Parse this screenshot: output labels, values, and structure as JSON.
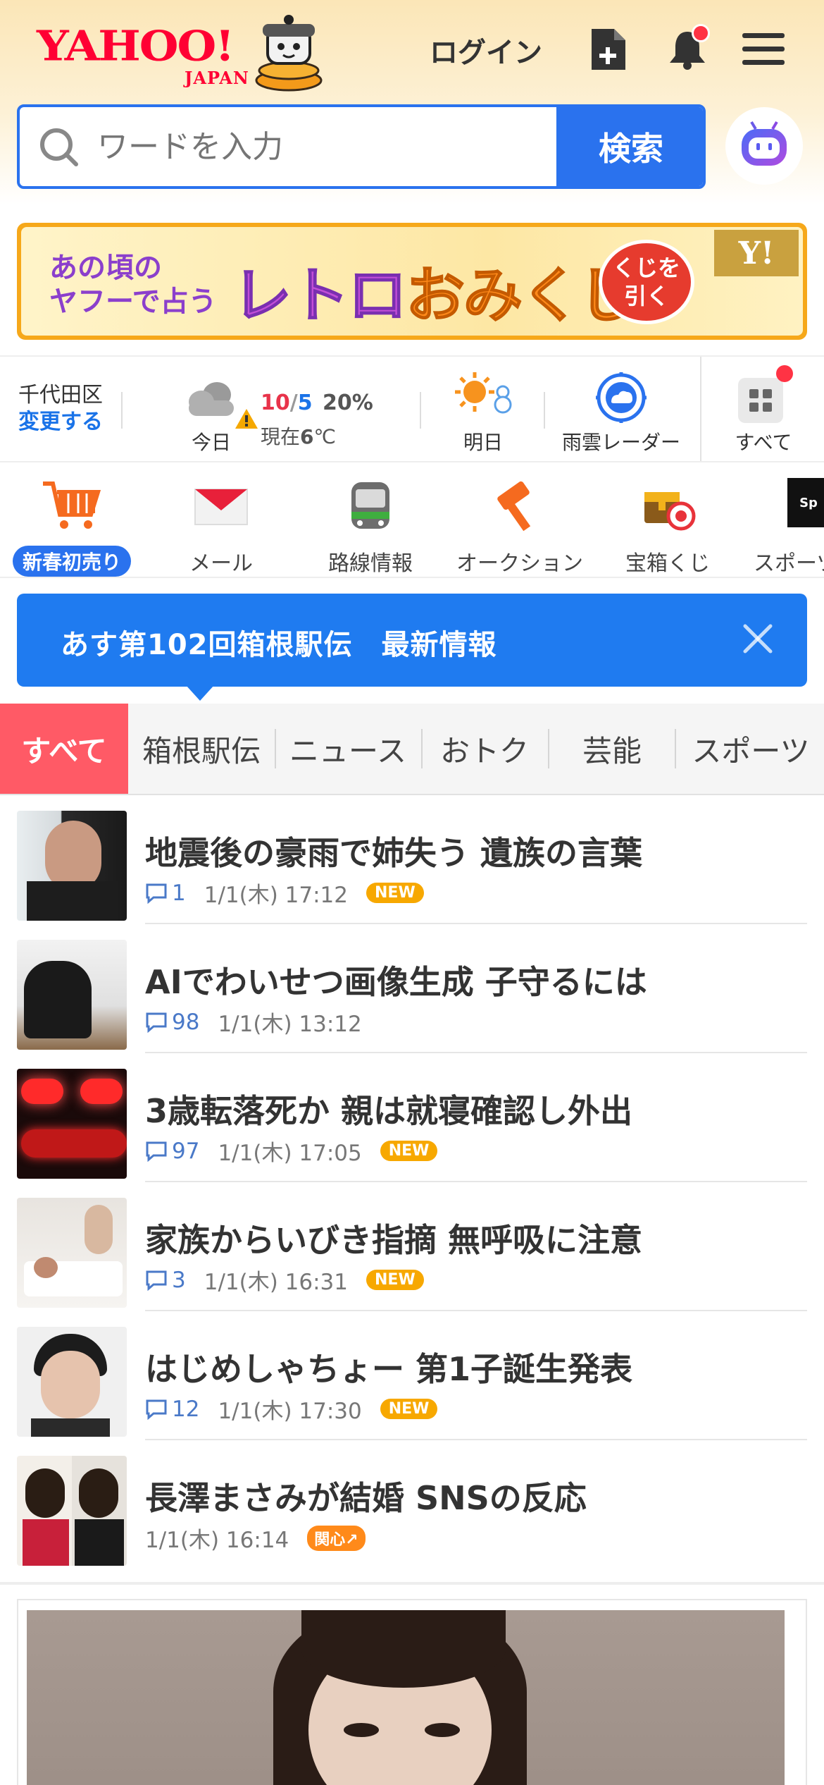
{
  "header": {
    "logo_text": "YAHOO!",
    "logo_sub": "JAPAN",
    "login_label": "ログイン",
    "search": {
      "placeholder": "ワードを入力",
      "button_label": "検索"
    }
  },
  "banner": {
    "subtitle_line1": "あの頃の",
    "subtitle_line2": "ヤフーで占う",
    "title_a": "レトロ",
    "title_b": "おみくじ",
    "cta_line1": "くじを",
    "cta_line2": "引く",
    "corner_logo": "Y!"
  },
  "weather": {
    "location": "千代田区",
    "change_label": "変更する",
    "today_label": "今日",
    "high": "10",
    "slash": "/",
    "low": "5",
    "rain": "20%",
    "now_prefix": "現在",
    "now_temp": "6",
    "now_unit": "℃",
    "tomorrow_label": "明日",
    "radar_label": "雨雲レーダー",
    "all_label": "すべて"
  },
  "apps": [
    {
      "label": "新春初売り"
    },
    {
      "label": "メール"
    },
    {
      "label": "路線情報"
    },
    {
      "label": "オークション"
    },
    {
      "label": "宝箱くじ"
    },
    {
      "label": "スポーツ"
    }
  ],
  "notice": {
    "text": "あす第102回箱根駅伝　最新情報"
  },
  "tabs": [
    "すべて",
    "箱根駅伝",
    "ニュース",
    "おトク",
    "芸能",
    "スポーツ"
  ],
  "news": [
    {
      "title": "地震後の豪雨で姉失う 遺族の言葉",
      "comments": "1",
      "time": "1/1(木) 17:12",
      "tag": "NEW"
    },
    {
      "title": "AIでわいせつ画像生成 子守るには",
      "comments": "98",
      "time": "1/1(木) 13:12",
      "tag": ""
    },
    {
      "title": "3歳転落死か 親は就寝確認し外出",
      "comments": "97",
      "time": "1/1(木) 17:05",
      "tag": "NEW"
    },
    {
      "title": "家族からいびき指摘 無呼吸に注意",
      "comments": "3",
      "time": "1/1(木) 16:31",
      "tag": "NEW"
    },
    {
      "title": "はじめしゃちょー 第1子誕生発表",
      "comments": "12",
      "time": "1/1(木) 17:30",
      "tag": "NEW"
    },
    {
      "title": "長澤まさみが結婚 SNSの反応",
      "comments": "",
      "time": "1/1(木) 16:14",
      "tag": "関心↗"
    }
  ],
  "colors": {
    "brand_red": "#ff0033",
    "search_blue": "#2a72ee",
    "tab_active": "#ff5a66",
    "new_tag": "#f7a800"
  }
}
